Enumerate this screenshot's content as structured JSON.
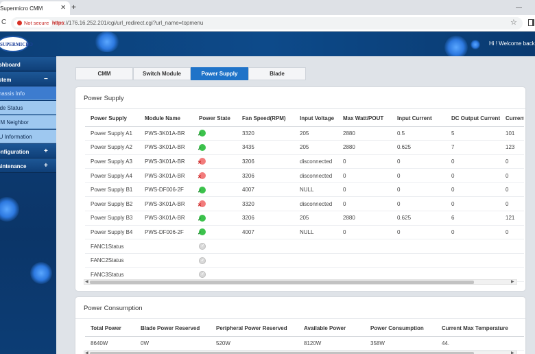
{
  "browser": {
    "tab_title": "Supermicro CMM",
    "not_secure_label": "Not secure",
    "url_protocol": "https",
    "url_rest": "://176.16.252.201/cgi/url_redirect.cgi?url_name=topmenu"
  },
  "header": {
    "logo_text": "SUPERMICRO",
    "welcome": "Hi ! Welcome back !"
  },
  "sidebar": {
    "items": [
      {
        "label": "Dashboard",
        "expander": ""
      },
      {
        "label": "System",
        "expander": "−"
      },
      {
        "label": "Chassis Info"
      },
      {
        "label": "Blade Status"
      },
      {
        "label": "CMM Neighbor"
      },
      {
        "label": "FRU Information"
      },
      {
        "label": "Configuration",
        "expander": "+"
      },
      {
        "label": "Maintenance",
        "expander": "+"
      }
    ]
  },
  "tabs": [
    "CMM",
    "Switch Module",
    "Power Supply",
    "Blade"
  ],
  "power_supply": {
    "title": "Power Supply",
    "columns": [
      "Power Supply",
      "Module Name",
      "Power State",
      "Fan Speed(RPM)",
      "Input Voltage",
      "Max Watt/POUT",
      "Input Current",
      "DC Output Current",
      "Current"
    ],
    "rows": [
      {
        "name": "Power Supply A1",
        "module": "PWS-3K01A-BR",
        "state": "on",
        "fan": "3320",
        "voltage": "205",
        "max_watt": "2880",
        "input_current": "0.5",
        "dc_output": "5",
        "current": "101"
      },
      {
        "name": "Power Supply A2",
        "module": "PWS-3K01A-BR",
        "state": "on",
        "fan": "3435",
        "voltage": "205",
        "max_watt": "2880",
        "input_current": "0.625",
        "dc_output": "7",
        "current": "123"
      },
      {
        "name": "Power Supply A3",
        "module": "PWS-3K01A-BR",
        "state": "off",
        "fan": "3206",
        "voltage": "disconnected",
        "max_watt": "0",
        "input_current": "0",
        "dc_output": "0",
        "current": "0"
      },
      {
        "name": "Power Supply A4",
        "module": "PWS-3K01A-BR",
        "state": "off",
        "fan": "3206",
        "voltage": "disconnected",
        "max_watt": "0",
        "input_current": "0",
        "dc_output": "0",
        "current": "0"
      },
      {
        "name": "Power Supply B1",
        "module": "PWS-DF006-2F",
        "state": "on",
        "fan": "4007",
        "voltage": "NULL",
        "max_watt": "0",
        "input_current": "0",
        "dc_output": "0",
        "current": "0"
      },
      {
        "name": "Power Supply B2",
        "module": "PWS-3K01A-BR",
        "state": "off",
        "fan": "3320",
        "voltage": "disconnected",
        "max_watt": "0",
        "input_current": "0",
        "dc_output": "0",
        "current": "0"
      },
      {
        "name": "Power Supply B3",
        "module": "PWS-3K01A-BR",
        "state": "on",
        "fan": "3206",
        "voltage": "205",
        "max_watt": "2880",
        "input_current": "0.625",
        "dc_output": "6",
        "current": "121"
      },
      {
        "name": "Power Supply B4",
        "module": "PWS-DF006-2F",
        "state": "on",
        "fan": "4007",
        "voltage": "NULL",
        "max_watt": "0",
        "input_current": "0",
        "dc_output": "0",
        "current": "0"
      },
      {
        "name": "FANC1Status",
        "module": "",
        "state": "na",
        "fan": "",
        "voltage": "",
        "max_watt": "",
        "input_current": "",
        "dc_output": "",
        "current": ""
      },
      {
        "name": "FANC2Status",
        "module": "",
        "state": "na",
        "fan": "",
        "voltage": "",
        "max_watt": "",
        "input_current": "",
        "dc_output": "",
        "current": ""
      },
      {
        "name": "FANC3Status",
        "module": "",
        "state": "na",
        "fan": "",
        "voltage": "",
        "max_watt": "",
        "input_current": "",
        "dc_output": "",
        "current": ""
      }
    ]
  },
  "power_consumption": {
    "title": "Power Consumption",
    "columns": [
      "Total Power",
      "Blade Power Reserved",
      "Peripheral Power Reserved",
      "Available Power",
      "Power Consumption",
      "Current Max Temperature"
    ],
    "values": [
      "8640W",
      "0W",
      "520W",
      "8120W",
      "358W",
      "44."
    ]
  },
  "colors": {
    "accent": "#1f73c8",
    "header": "#0d4a8a",
    "on": "#3cc24c",
    "off": "#f27c7c"
  }
}
